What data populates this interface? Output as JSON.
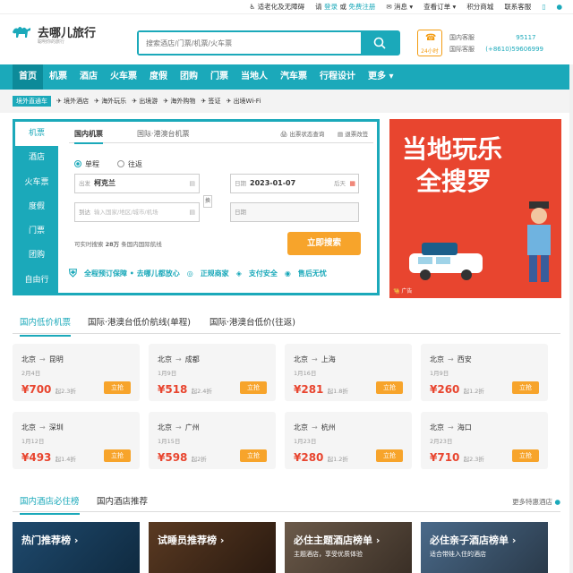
{
  "topbar": {
    "accessibility": "适老化及无障碍",
    "please": "请",
    "login": "登录",
    "or": "或",
    "register": "免费注册",
    "messages": "消息",
    "orders": "查看订单",
    "points_mall": "积分商城",
    "contact": "联系客服"
  },
  "logo": {
    "name": "去哪儿旅行",
    "slogan": "聪明你的旅行"
  },
  "search": {
    "placeholder": "搜索酒店/门票/机票/火车票"
  },
  "service": {
    "badge": "24小时",
    "domestic_label": "国内客服",
    "domestic_value": "95117",
    "intl_label": "国际客服",
    "intl_value": "(+8610)59606999"
  },
  "nav": [
    "首页",
    "机票",
    "酒店",
    "火车票",
    "度假",
    "团购",
    "门票",
    "当地人",
    "汽车票",
    "行程设计",
    "更多"
  ],
  "subnav": [
    "境外直通车",
    "境外酒店",
    "海外玩乐",
    "出境游",
    "海外购物",
    "签证",
    "出境Wi-Fi"
  ],
  "booking": {
    "side": [
      "机票",
      "酒店",
      "火车票",
      "度假",
      "门票",
      "团购",
      "自由行"
    ],
    "tab_domestic": "国内机票",
    "tab_intl": "国际·港澳台机票",
    "status_query": "出票状态查询",
    "refund": "退票改签",
    "oneway": "单程",
    "roundtrip": "往返",
    "from_label": "出发",
    "from_value": "柯克兰",
    "to_label": "到达",
    "to_placeholder": "输入国家/地区/城市/机场",
    "date_label": "日期",
    "date_value": "2023-01-07",
    "date_hint": "后天",
    "return_label": "日期",
    "swap": "换",
    "hint_prefix": "可实时搜索",
    "hint_count": "28万",
    "hint_suffix": "条国内国际航线",
    "search_button": "立即搜索",
    "guarantee": [
      "全程预订保障 • 去哪儿都放心",
      "正规商家",
      "支付安全",
      "售后无忧"
    ]
  },
  "ad": {
    "line1": "当地玩乐",
    "line2": "全搜罗",
    "label": "广告"
  },
  "lowfare_tabs": [
    "国内低价机票",
    "国际·港澳台低价航线(单程)",
    "国际·港澳台低价(往返)"
  ],
  "fares": [
    {
      "from": "北京",
      "to": "昆明",
      "date": "2月4日",
      "price": "¥700",
      "discount": "起2.3折",
      "buy": "立抢"
    },
    {
      "from": "北京",
      "to": "成都",
      "date": "1月9日",
      "price": "¥518",
      "discount": "起2.4折",
      "buy": "立抢"
    },
    {
      "from": "北京",
      "to": "上海",
      "date": "1月16日",
      "price": "¥281",
      "discount": "起1.8折",
      "buy": "立抢"
    },
    {
      "from": "北京",
      "to": "西安",
      "date": "1月9日",
      "price": "¥260",
      "discount": "起1.2折",
      "buy": "立抢"
    },
    {
      "from": "北京",
      "to": "深圳",
      "date": "1月12日",
      "price": "¥493",
      "discount": "起1.4折",
      "buy": "立抢"
    },
    {
      "from": "北京",
      "to": "广州",
      "date": "1月15日",
      "price": "¥598",
      "discount": "起2折",
      "buy": "立抢"
    },
    {
      "from": "北京",
      "to": "杭州",
      "date": "1月23日",
      "price": "¥280",
      "discount": "起1.2折",
      "buy": "立抢"
    },
    {
      "from": "北京",
      "to": "海口",
      "date": "2月23日",
      "price": "¥710",
      "discount": "起2.3折",
      "buy": "立抢"
    }
  ],
  "hotel_tabs": [
    "国内酒店必住榜",
    "国内酒店推荐"
  ],
  "hotel_more": "更多特惠酒店",
  "hotel_cards": [
    {
      "title": "热门推荐榜 ›",
      "sub": ""
    },
    {
      "title": "试睡员推荐榜 ›",
      "sub": ""
    },
    {
      "title": "必住主题酒店榜单 ›",
      "sub": "主题酒店，享受优质体验"
    },
    {
      "title": "必住亲子酒店榜单 ›",
      "sub": "适合带娃入住的酒店"
    }
  ],
  "colors": {
    "accent": "#1ba9ba",
    "orange": "#f7a42b",
    "price": "#e8452f"
  }
}
